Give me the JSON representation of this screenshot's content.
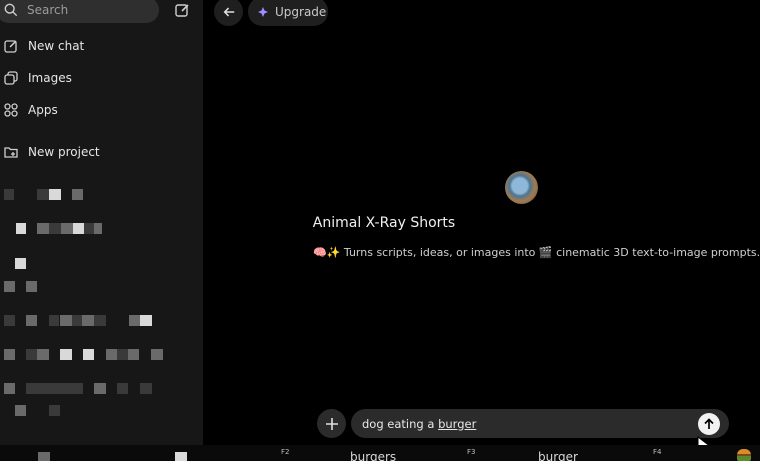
{
  "sidebar": {
    "search_placeholder": "Search",
    "items": [
      {
        "label": "New chat",
        "icon": "edit-icon"
      },
      {
        "label": "Images",
        "icon": "images-icon"
      },
      {
        "label": "Apps",
        "icon": "apps-grid-icon"
      },
      {
        "label": "New project",
        "icon": "folder-plus-icon"
      }
    ]
  },
  "header": {
    "upgrade_label": "Upgrade"
  },
  "gpt": {
    "name": "Animal X-Ray Shorts",
    "description": "🧠✨ Turns scripts, ideas, or images into 🎬 cinematic 3D text-to-image prompts."
  },
  "composer": {
    "text_prefix": "dog eating a ",
    "text_word": "burger"
  },
  "keyboard": {
    "fkeys": [
      "F2",
      "F3",
      "F4"
    ],
    "suggestions": [
      "burgers",
      "burger"
    ]
  },
  "colors": {
    "background": "#000000",
    "sidebar": "#171717",
    "pill": "#2b2b2b",
    "upgrade_accent": "#a08cff"
  }
}
